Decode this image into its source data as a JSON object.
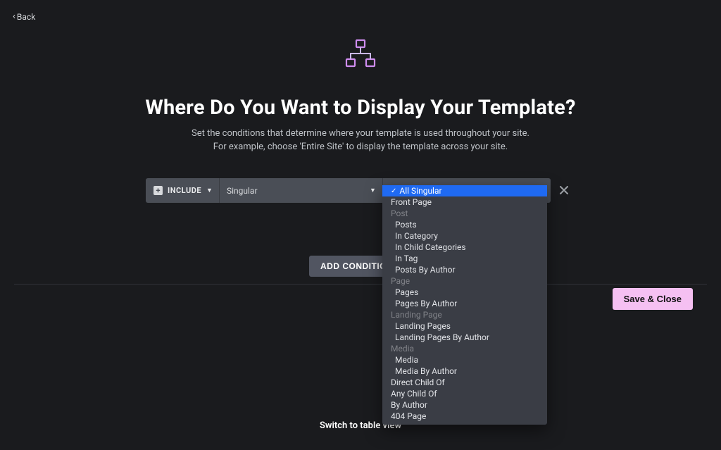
{
  "back": {
    "label": "Back"
  },
  "header": {
    "title": "Where Do You Want to Display Your Template?",
    "subtitle_line1": "Set the conditions that determine where your template is used throughout your site.",
    "subtitle_line2": "For example, choose 'Entire Site' to display the template across your site."
  },
  "condition": {
    "include_label": "INCLUDE",
    "scope_selected": "Singular",
    "value_selected": "All Singular"
  },
  "dropdown": {
    "selected": "All Singular",
    "items": [
      {
        "type": "item",
        "label": "All Singular",
        "selected": true,
        "top": true
      },
      {
        "type": "item",
        "label": "Front Page",
        "top": true
      },
      {
        "type": "group",
        "label": "Post"
      },
      {
        "type": "item",
        "label": "Posts"
      },
      {
        "type": "item",
        "label": "In Category"
      },
      {
        "type": "item",
        "label": "In Child Categories"
      },
      {
        "type": "item",
        "label": "In Tag"
      },
      {
        "type": "item",
        "label": "Posts By Author"
      },
      {
        "type": "group",
        "label": "Page"
      },
      {
        "type": "item",
        "label": "Pages"
      },
      {
        "type": "item",
        "label": "Pages By Author"
      },
      {
        "type": "group",
        "label": "Landing Page"
      },
      {
        "type": "item",
        "label": "Landing Pages"
      },
      {
        "type": "item",
        "label": "Landing Pages By Author"
      },
      {
        "type": "group",
        "label": "Media"
      },
      {
        "type": "item",
        "label": "Media"
      },
      {
        "type": "item",
        "label": "Media By Author"
      },
      {
        "type": "item",
        "label": "Direct Child Of",
        "top": true
      },
      {
        "type": "item",
        "label": "Any Child Of",
        "top": true
      },
      {
        "type": "item",
        "label": "By Author",
        "top": true
      },
      {
        "type": "item",
        "label": "404 Page",
        "top": true
      }
    ]
  },
  "buttons": {
    "add_condition": "ADD CONDITION",
    "save_close": "Save & Close"
  },
  "footer": {
    "switch_label": "Switch to table view"
  },
  "colors": {
    "accent_pink": "#f5c0f2",
    "accent_purple": "#b571e2",
    "highlight_blue": "#1f6af2",
    "bg": "#1a1b1e"
  }
}
